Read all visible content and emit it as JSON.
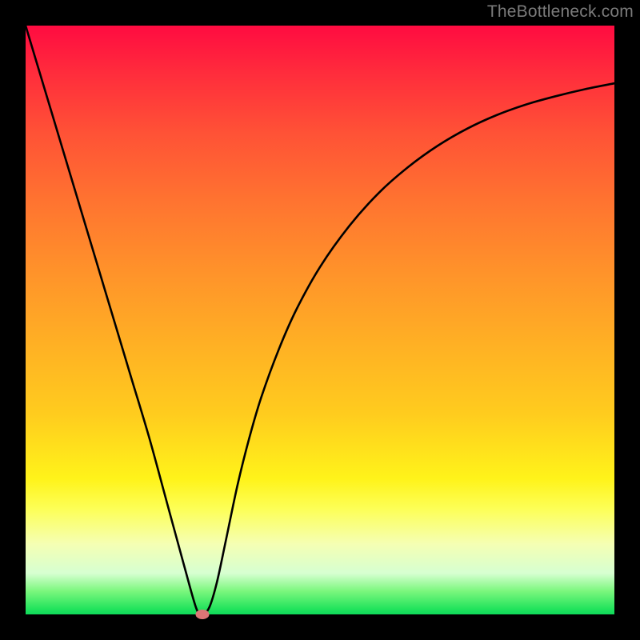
{
  "watermark": "TheBottleneck.com",
  "chart_data": {
    "type": "line",
    "title": "",
    "xlabel": "",
    "ylabel": "",
    "xlim": [
      0,
      1
    ],
    "ylim": [
      0,
      1
    ],
    "series": [
      {
        "name": "curve",
        "x": [
          0.0,
          0.03,
          0.06,
          0.09,
          0.12,
          0.15,
          0.18,
          0.21,
          0.24,
          0.27,
          0.29,
          0.3,
          0.312,
          0.325,
          0.34,
          0.36,
          0.38,
          0.4,
          0.43,
          0.46,
          0.5,
          0.55,
          0.6,
          0.65,
          0.7,
          0.75,
          0.8,
          0.85,
          0.9,
          0.95,
          1.0
        ],
        "y": [
          1.0,
          0.9,
          0.8,
          0.7,
          0.6,
          0.5,
          0.4,
          0.3,
          0.19,
          0.08,
          0.01,
          0.0,
          0.012,
          0.055,
          0.125,
          0.22,
          0.3,
          0.368,
          0.45,
          0.518,
          0.59,
          0.66,
          0.716,
          0.76,
          0.796,
          0.825,
          0.848,
          0.866,
          0.88,
          0.892,
          0.902
        ]
      }
    ],
    "marker": {
      "x": 0.3,
      "y": 0.0
    },
    "gradient_stops": [
      {
        "pos": 0.0,
        "color": "#ff0b41"
      },
      {
        "pos": 0.5,
        "color": "#ffb024"
      },
      {
        "pos": 0.8,
        "color": "#fff31a"
      },
      {
        "pos": 1.0,
        "color": "#0fd95a"
      }
    ]
  }
}
